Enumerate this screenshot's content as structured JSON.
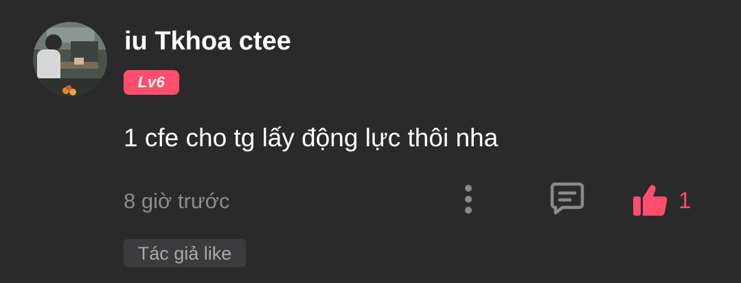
{
  "comment": {
    "author": {
      "name": "iu Tkhoa ctee",
      "level": "Lv6",
      "avatar_icon": "user-avatar-photo"
    },
    "text": "1 cfe cho tg lấy động lực thôi nha",
    "timestamp": "8 giờ trước",
    "actions": {
      "more_icon": "more-vertical-icon",
      "reply_icon": "comment-icon",
      "like_icon": "thumbs-up-icon",
      "like_count": "1"
    },
    "author_liked_label": "Tác giả like"
  },
  "colors": {
    "background": "#2a2a2b",
    "accent": "#ff4d6d",
    "primary_text": "#ffffff",
    "secondary_text": "#8c8c8c",
    "icon_gray": "#8a8a8a",
    "tag_background": "#3b3b3d"
  }
}
